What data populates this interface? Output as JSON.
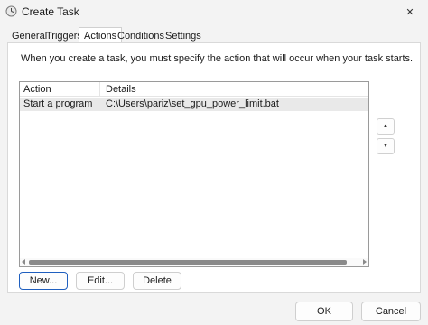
{
  "window": {
    "title": "Create Task",
    "close_glyph": "✕",
    "icon": "task-scheduler-icon"
  },
  "tabs": [
    {
      "label": "General",
      "active": false
    },
    {
      "label": "Triggers",
      "active": false
    },
    {
      "label": "Actions",
      "active": true
    },
    {
      "label": "Conditions",
      "active": false
    },
    {
      "label": "Settings",
      "active": false
    }
  ],
  "panel": {
    "instruction": "When you create a task, you must specify the action that will occur when your task starts."
  },
  "actions_list": {
    "columns": [
      "Action",
      "Details"
    ],
    "rows": [
      {
        "action": "Start a program",
        "details": "C:\\Users\\pariz\\set_gpu_power_limit.bat"
      }
    ]
  },
  "side_buttons": {
    "move_up": "▲",
    "move_down": "▼"
  },
  "list_buttons": {
    "new": "New...",
    "edit": "Edit...",
    "delete": "Delete"
  },
  "dialog_buttons": {
    "ok": "OK",
    "cancel": "Cancel"
  },
  "colors": {
    "accent": "#1f5fbf",
    "selected_row": "#e9e9e9"
  }
}
